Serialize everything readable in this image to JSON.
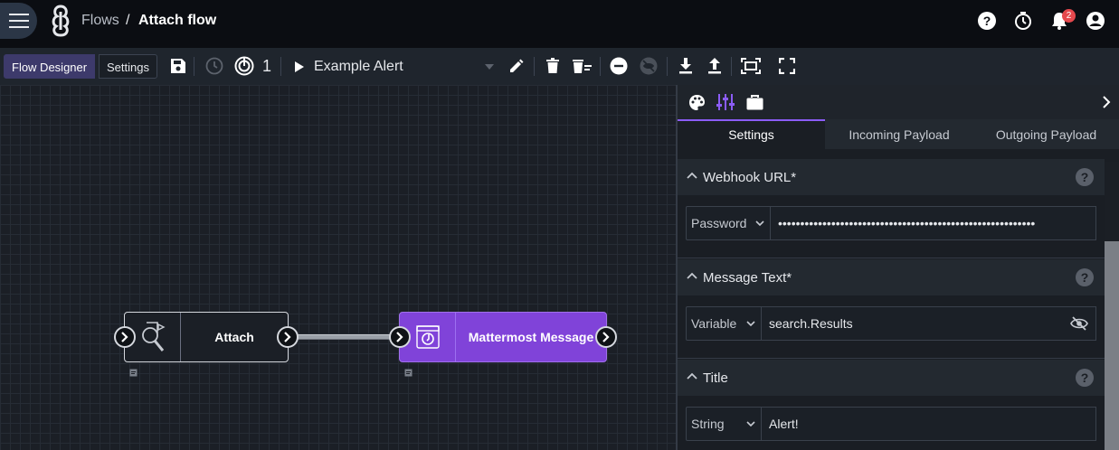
{
  "breadcrumb": {
    "parent": "Flows",
    "separator": "/",
    "current": "Attach flow"
  },
  "notifications": {
    "badge_count": "2"
  },
  "toolbar": {
    "designer_tab": "Flow Designer",
    "settings_tab": "Settings",
    "trigger_count": "1",
    "selected_flow": "Example Alert"
  },
  "nodes": [
    {
      "label": "Attach"
    },
    {
      "label": "Mattermost Message"
    }
  ],
  "panel": {
    "tabs": [
      "Settings",
      "Incoming Payload",
      "Outgoing Payload"
    ],
    "fields": [
      {
        "title": "Webhook URL*",
        "type": "Password",
        "value": "••••••••••••••••••••••••••••••••••••••••••••••••••••••••••"
      },
      {
        "title": "Message Text*",
        "type": "Variable",
        "value": "search.Results"
      },
      {
        "title": "Title",
        "type": "String",
        "value": "Alert!"
      }
    ],
    "help_glyph": "?"
  },
  "colors": {
    "accent": "#8b5cf6",
    "node_active": "#8043d9",
    "badge": "#e5484d"
  }
}
